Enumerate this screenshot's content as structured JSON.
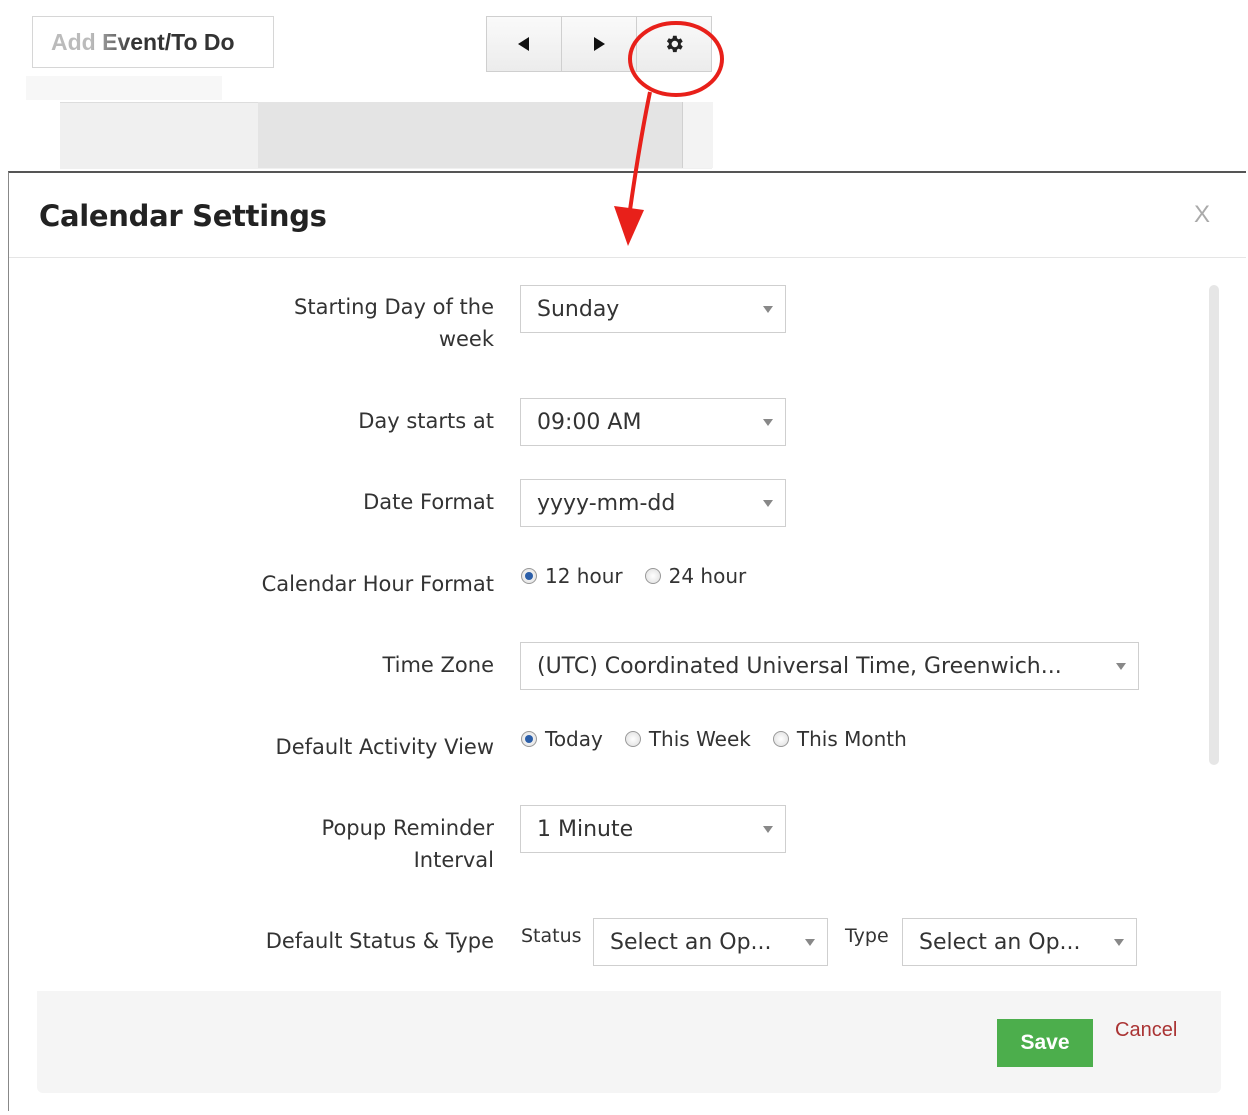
{
  "toolbar": {
    "add_event_label": "Add Event/To Do",
    "prev_icon": "triangle-left-icon",
    "next_icon": "triangle-right-icon",
    "settings_icon": "gear-icon"
  },
  "annotation": {
    "color": "#e8201a",
    "description_icon": "red-circle-arrow"
  },
  "modal": {
    "title": "Calendar Settings",
    "close_label": "X",
    "fields": {
      "starting_day": {
        "label_line1": "Starting Day of the",
        "label_line2": "week",
        "value": "Sunday"
      },
      "day_starts_at": {
        "label": "Day starts at",
        "value": "09:00 AM"
      },
      "date_format": {
        "label": "Date Format",
        "value": "yyyy-mm-dd"
      },
      "hour_format": {
        "label": "Calendar Hour Format",
        "options": [
          "12 hour",
          "24 hour"
        ],
        "selected": "12 hour"
      },
      "time_zone": {
        "label": "Time Zone",
        "value": "(UTC) Coordinated Universal Time, Greenwich..."
      },
      "activity_view": {
        "label": "Default Activity View",
        "options": [
          "Today",
          "This Week",
          "This Month"
        ],
        "selected": "Today"
      },
      "reminder": {
        "label_line1": "Popup Reminder",
        "label_line2": "Interval",
        "value": "1 Minute"
      },
      "status_type": {
        "label": "Default Status & Type",
        "status_label": "Status",
        "status_value": "Select an Op...",
        "type_label": "Type",
        "type_value": "Select an Op..."
      }
    },
    "footer": {
      "save_label": "Save",
      "cancel_label": "Cancel",
      "save_color": "#4cae4c"
    }
  }
}
